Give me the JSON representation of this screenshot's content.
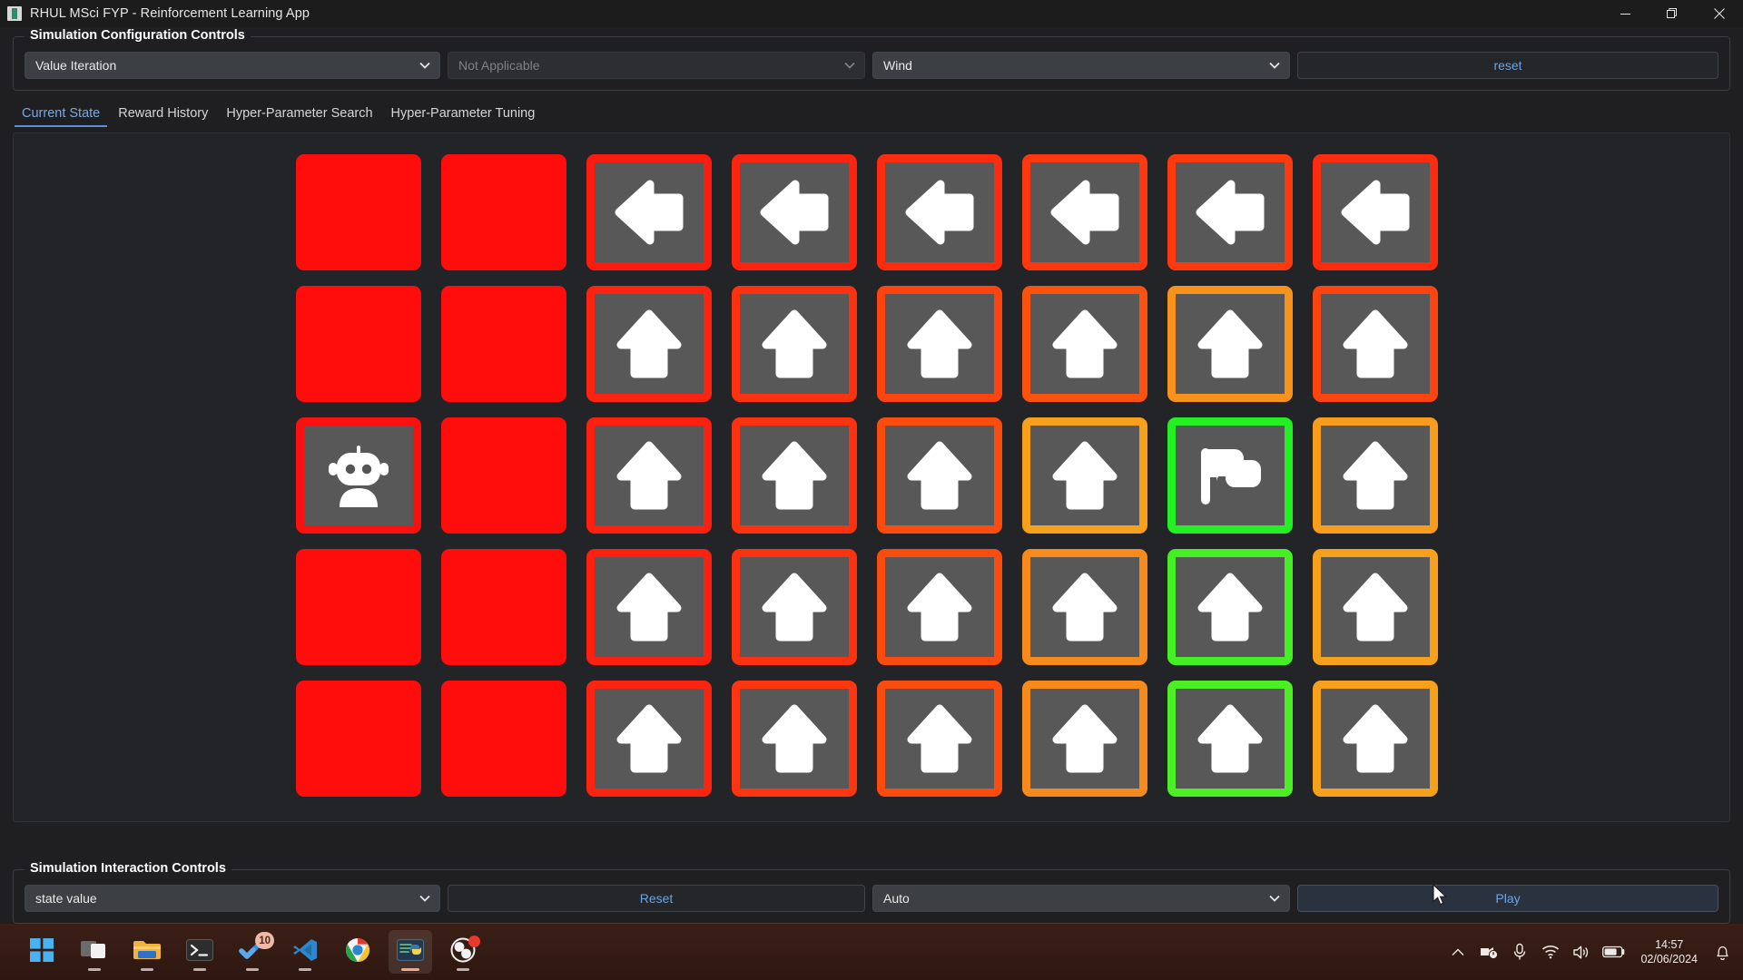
{
  "window": {
    "title": "RHUL MSci FYP - Reinforcement Learning App",
    "icon": "app-icon",
    "minimize_label": "—",
    "restore_label": "□",
    "close_label": "✕"
  },
  "config": {
    "legend": "Simulation Configuration Controls",
    "algorithm_value": "Value Iteration",
    "secondary_value": "Not Applicable",
    "environment_value": "Wind",
    "reset_label": "reset"
  },
  "tabs": [
    {
      "label": "Current State",
      "active": true
    },
    {
      "label": "Reward History",
      "active": false
    },
    {
      "label": "Hyper-Parameter Search",
      "active": false
    },
    {
      "label": "Hyper-Parameter Tuning",
      "active": false
    }
  ],
  "interaction": {
    "legend": "Simulation Interaction Controls",
    "display_mode_value": "state value",
    "reset_label": "Reset",
    "speed_value": "Auto",
    "play_label": "Play"
  },
  "colors": {
    "blocked": "#ff0d0d",
    "cell_bg": "#585858",
    "goal_border": "#23ef23",
    "accent_text": "#6ea3e0",
    "panel_bg": "#232427"
  },
  "grid": {
    "rows": 5,
    "cols": 8,
    "cells": [
      [
        {
          "type": "blocked"
        },
        {
          "type": "blocked"
        },
        {
          "type": "arrow",
          "dir": "left",
          "border": "#fb1c10"
        },
        {
          "type": "arrow",
          "dir": "left",
          "border": "#fb2410"
        },
        {
          "type": "arrow",
          "dir": "left",
          "border": "#fb2c10"
        },
        {
          "type": "arrow",
          "dir": "left",
          "border": "#fb3810"
        },
        {
          "type": "arrow",
          "dir": "left",
          "border": "#fb3a10"
        },
        {
          "type": "arrow",
          "dir": "left",
          "border": "#fb2c10"
        }
      ],
      [
        {
          "type": "blocked"
        },
        {
          "type": "blocked"
        },
        {
          "type": "arrow",
          "dir": "up",
          "border": "#fb2410"
        },
        {
          "type": "arrow",
          "dir": "up",
          "border": "#fb3210"
        },
        {
          "type": "arrow",
          "dir": "up",
          "border": "#fb4410"
        },
        {
          "type": "arrow",
          "dir": "up",
          "border": "#fb5210"
        },
        {
          "type": "arrow",
          "dir": "up",
          "border": "#f7921c"
        },
        {
          "type": "arrow",
          "dir": "up",
          "border": "#fb4410"
        }
      ],
      [
        {
          "type": "agent",
          "border": "#fb1010"
        },
        {
          "type": "blocked"
        },
        {
          "type": "arrow",
          "dir": "up",
          "border": "#fb2010"
        },
        {
          "type": "arrow",
          "dir": "up",
          "border": "#fb3210"
        },
        {
          "type": "arrow",
          "dir": "up",
          "border": "#fb4c10"
        },
        {
          "type": "arrow",
          "dir": "up",
          "border": "#f7a01c"
        },
        {
          "type": "goal",
          "border": "#23ef23"
        },
        {
          "type": "arrow",
          "dir": "up",
          "border": "#f79c1c"
        }
      ],
      [
        {
          "type": "blocked"
        },
        {
          "type": "blocked"
        },
        {
          "type": "arrow",
          "dir": "up",
          "border": "#fb2010"
        },
        {
          "type": "arrow",
          "dir": "up",
          "border": "#fb3210"
        },
        {
          "type": "arrow",
          "dir": "up",
          "border": "#fb4c10"
        },
        {
          "type": "arrow",
          "dir": "up",
          "border": "#f78a1c"
        },
        {
          "type": "arrow",
          "dir": "up",
          "border": "#44ef23"
        },
        {
          "type": "arrow",
          "dir": "up",
          "border": "#f7a01c"
        }
      ],
      [
        {
          "type": "blocked"
        },
        {
          "type": "blocked"
        },
        {
          "type": "arrow",
          "dir": "up",
          "border": "#fb2410"
        },
        {
          "type": "arrow",
          "dir": "up",
          "border": "#fb3610"
        },
        {
          "type": "arrow",
          "dir": "up",
          "border": "#fb4c10"
        },
        {
          "type": "arrow",
          "dir": "up",
          "border": "#f78a1c"
        },
        {
          "type": "arrow",
          "dir": "up",
          "border": "#4cef23"
        },
        {
          "type": "arrow",
          "dir": "up",
          "border": "#f7a01c"
        }
      ]
    ]
  },
  "taskbar": {
    "items": [
      {
        "name": "start-button",
        "icon": "windows-logo"
      },
      {
        "name": "task-view-button",
        "icon": "task-view"
      },
      {
        "name": "file-explorer-button",
        "icon": "folder"
      },
      {
        "name": "terminal-button",
        "icon": "terminal"
      },
      {
        "name": "todo-button",
        "icon": "check-badge",
        "badge": "10"
      },
      {
        "name": "vscode-button",
        "icon": "vscode"
      },
      {
        "name": "chrome-button",
        "icon": "chrome"
      },
      {
        "name": "python-app-button",
        "icon": "python-window",
        "active": true
      },
      {
        "name": "obs-button",
        "icon": "obs",
        "alert": true
      }
    ],
    "tray": {
      "chevron": "chevron-up-icon",
      "obs_tray": "obs-tray-icon",
      "microphone": "microphone-icon",
      "wifi": "wifi-icon",
      "speaker": "speaker-icon",
      "battery": "battery-icon",
      "time": "14:57",
      "date": "02/06/2024",
      "notifications": "bell-icon"
    }
  }
}
